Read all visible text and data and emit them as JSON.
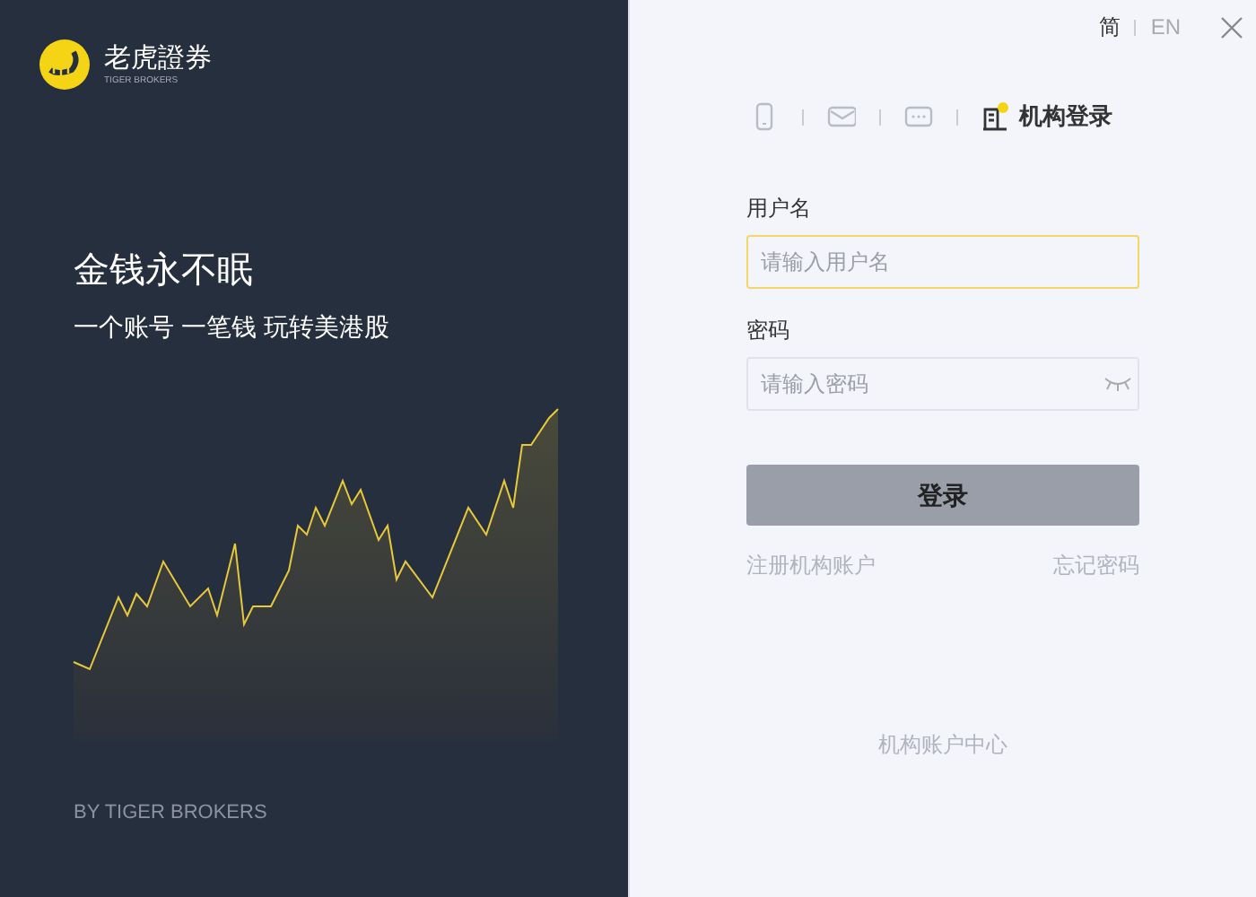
{
  "brand": {
    "name": "老虎證券",
    "tagline": "TIGER BROKERS"
  },
  "headline": "金钱永不眠",
  "subheadline": "一个账号 一笔钱 玩转美港股",
  "footer": "BY TIGER BROKERS",
  "languages": [
    {
      "label": "简",
      "selected": true
    },
    {
      "label": "EN",
      "selected": false
    }
  ],
  "login_tabs": [
    {
      "kind": "phone",
      "selected": false
    },
    {
      "kind": "mail",
      "selected": false
    },
    {
      "kind": "chat",
      "selected": false
    },
    {
      "kind": "institution",
      "label": "机构登录",
      "selected": true
    }
  ],
  "fields": [
    {
      "label": "用户名",
      "placeholder": "请输入用户名",
      "focused": true,
      "kind": "text"
    },
    {
      "label": "密码",
      "placeholder": "请输入密码",
      "focused": false,
      "kind": "password"
    }
  ],
  "login_button": "登录",
  "links": [
    "注册机构账户",
    "忘记密码"
  ],
  "bottom_link": "机构账户中心"
}
